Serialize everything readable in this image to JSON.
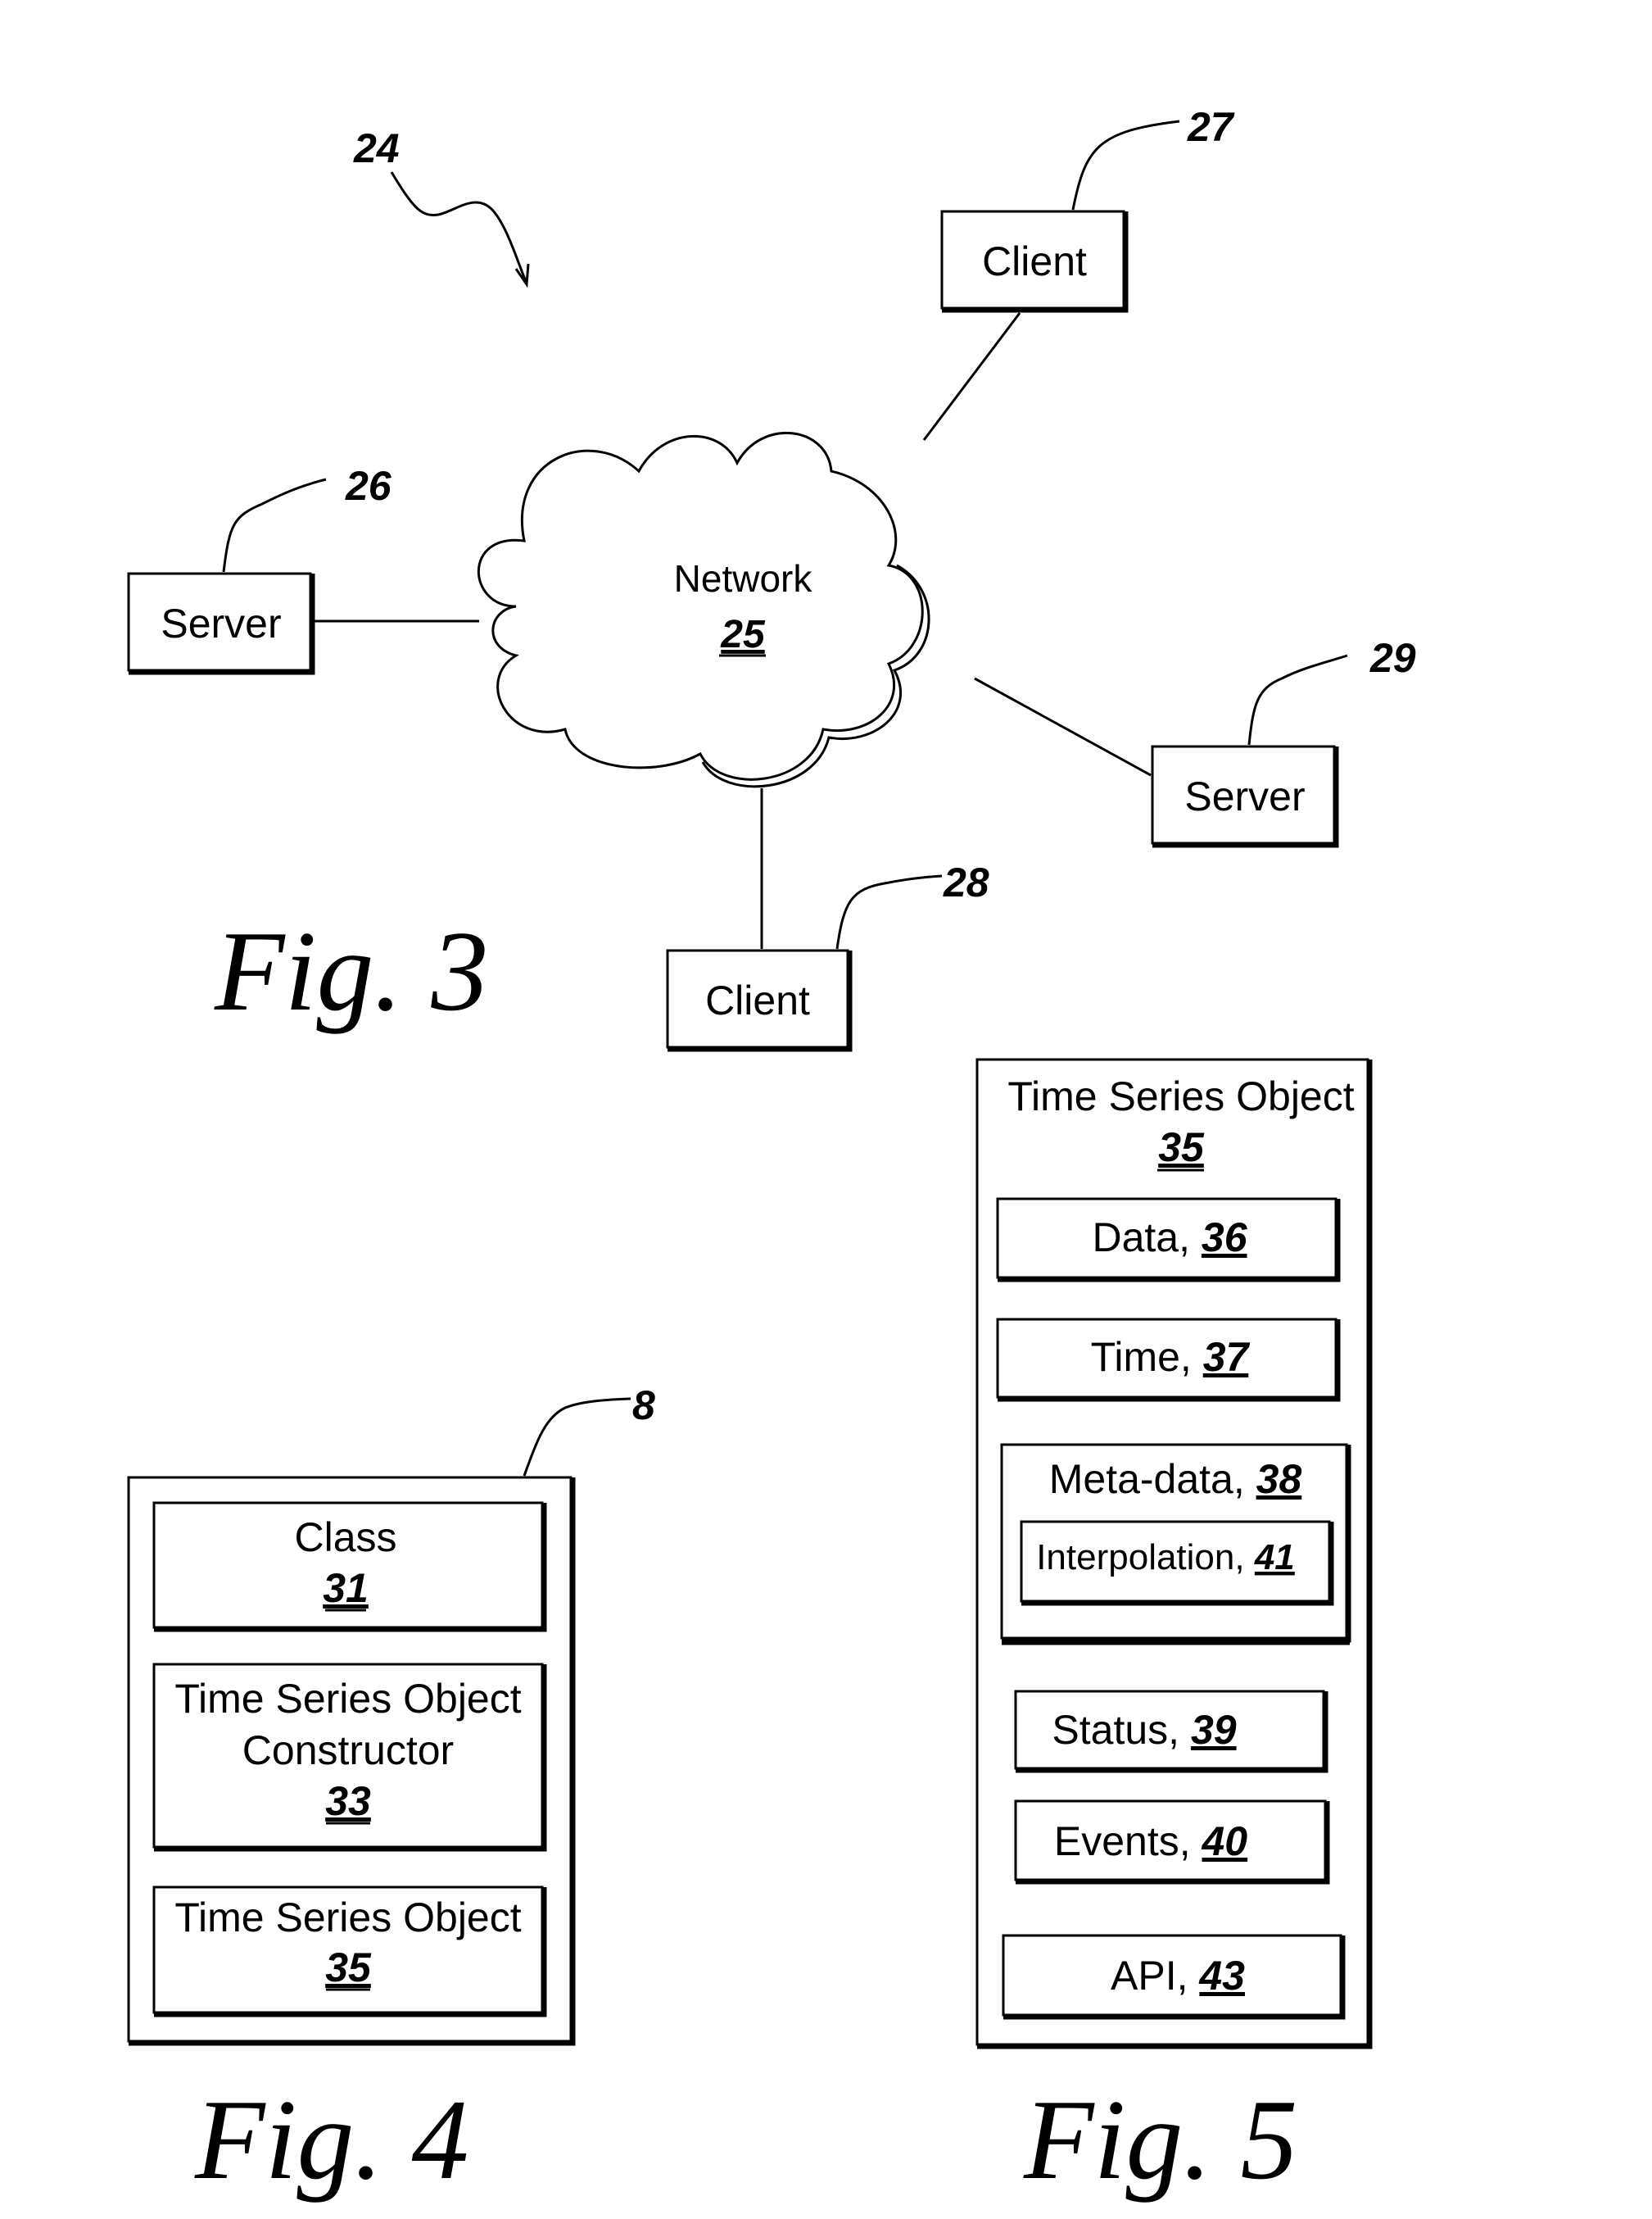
{
  "fig3": {
    "caption": "Fig. 3",
    "system_ref": "24",
    "network": {
      "label": "Network",
      "ref": "25"
    },
    "nodes": [
      {
        "id": "client-27",
        "label": "Client",
        "ref": "27"
      },
      {
        "id": "server-26",
        "label": "Server",
        "ref": "26"
      },
      {
        "id": "server-29",
        "label": "Server",
        "ref": "29"
      },
      {
        "id": "client-28",
        "label": "Client",
        "ref": "28"
      }
    ]
  },
  "fig4": {
    "caption": "Fig. 4",
    "container_ref": "8",
    "blocks": [
      {
        "lines": [
          "Class"
        ],
        "ref": "31"
      },
      {
        "lines": [
          "Time Series Object",
          "Constructor"
        ],
        "ref": "33"
      },
      {
        "lines": [
          "Time Series Object"
        ],
        "ref": "35"
      }
    ]
  },
  "fig5": {
    "caption": "Fig. 5",
    "title": "Time Series Object",
    "title_ref": "35",
    "blocks": [
      {
        "label": "Data, ",
        "ref": "36"
      },
      {
        "label": "Time, ",
        "ref": "37"
      },
      {
        "label": "Meta-data, ",
        "ref": "38"
      },
      {
        "label": "Interpolation, ",
        "ref": "41"
      },
      {
        "label": "Status, ",
        "ref": "39"
      },
      {
        "label": "Events, ",
        "ref": "40"
      },
      {
        "label": "API, ",
        "ref": "43"
      }
    ]
  }
}
